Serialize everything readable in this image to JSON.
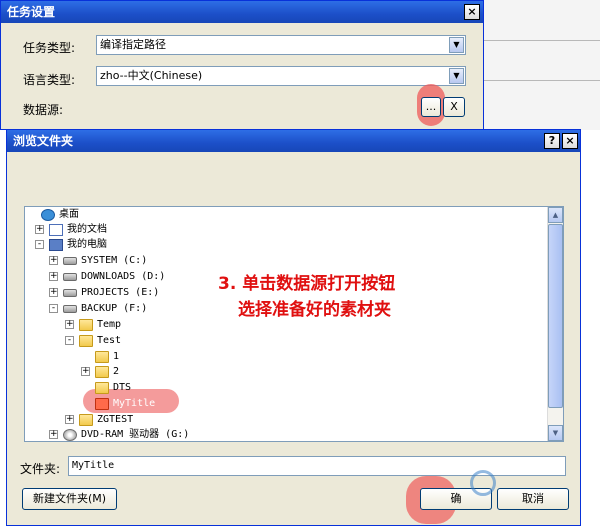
{
  "task_dialog": {
    "title": "任务设置",
    "close": "×",
    "task_type_label": "任务类型:",
    "task_type_value": "编译指定路径",
    "language_label": "语言类型:",
    "language_value": "zho--中文(Chinese)",
    "source_label": "数据源:",
    "source_value": "",
    "browse_button": "...",
    "clear_button": "X"
  },
  "browse_dialog": {
    "title": "浏览文件夹",
    "help": "?",
    "close": "×",
    "tree": [
      {
        "label": "桌面",
        "icon": "desktop-icon"
      },
      {
        "label": "我的文档",
        "icon": "documents-icon",
        "expander": "+"
      },
      {
        "label": "我的电脑",
        "icon": "computer-icon",
        "expander": "-"
      },
      {
        "label": "SYSTEM (C:)",
        "icon": "drive-icon",
        "expander": "+"
      },
      {
        "label": "DOWNLOADS (D:)",
        "icon": "drive-icon",
        "expander": "+"
      },
      {
        "label": "PROJECTS (E:)",
        "icon": "drive-icon",
        "expander": "+"
      },
      {
        "label": "BACKUP (F:)",
        "icon": "drive-icon",
        "expander": "-"
      },
      {
        "label": "Temp",
        "icon": "folder-icon",
        "expander": "+"
      },
      {
        "label": "Test",
        "icon": "folder-open-icon",
        "expander": "-"
      },
      {
        "label": "1",
        "icon": "folder-icon"
      },
      {
        "label": "2",
        "icon": "folder-icon",
        "expander": "+"
      },
      {
        "label": "DTS",
        "icon": "folder-icon"
      },
      {
        "label": "MyTitle",
        "icon": "folder-icon",
        "selected": true
      },
      {
        "label": "ZGTEST",
        "icon": "folder-icon",
        "expander": "+"
      },
      {
        "label": "DVD-RAM 驱动器 (G:)",
        "icon": "dvd-drive-icon",
        "expander": "+"
      }
    ],
    "folder_label": "文件夹:",
    "folder_value": "MyTitle",
    "new_folder_button": "新建文件夹(M)",
    "ok_button": "确",
    "cancel_button": "取消"
  },
  "annotation": {
    "line1": "3. 单击数据源打开按钮",
    "line2": "选择准备好的素材夹"
  },
  "colors": {
    "title_bar": "#2e6ee6",
    "dialog_bg": "#ece9d8",
    "annotation": "#e01010",
    "highlight": "#f08080"
  }
}
